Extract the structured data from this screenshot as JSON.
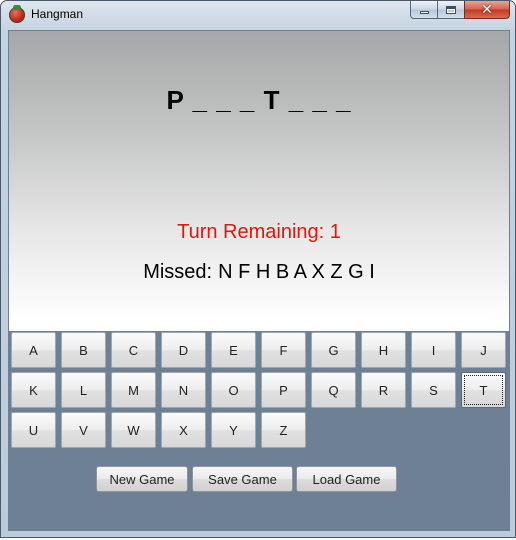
{
  "window": {
    "title": "Hangman",
    "icon": "hangman-app-icon",
    "controls": {
      "minimize": "minimize-icon",
      "maximize": "maximize-icon",
      "close": "close-icon"
    }
  },
  "game": {
    "word_display": "P _ _ _ T _ _ _",
    "turns_label": "Turn Remaining: 1",
    "missed_label": "Missed:",
    "missed_letters": "N F H B A X Z G I"
  },
  "keyboard": {
    "rows": [
      [
        "A",
        "B",
        "C",
        "D",
        "E",
        "F",
        "G",
        "H",
        "I",
        "J"
      ],
      [
        "K",
        "L",
        "M",
        "N",
        "O",
        "P",
        "Q",
        "R",
        "S",
        "T"
      ],
      [
        "U",
        "V",
        "W",
        "X",
        "Y",
        "Z"
      ]
    ],
    "focused_key": "T"
  },
  "actions": {
    "new_game": "New Game",
    "save_game": "Save Game",
    "load_game": "Load Game"
  },
  "colors": {
    "turns_text": "#e3160b",
    "panel_bg_bottom": "#6e8093"
  }
}
